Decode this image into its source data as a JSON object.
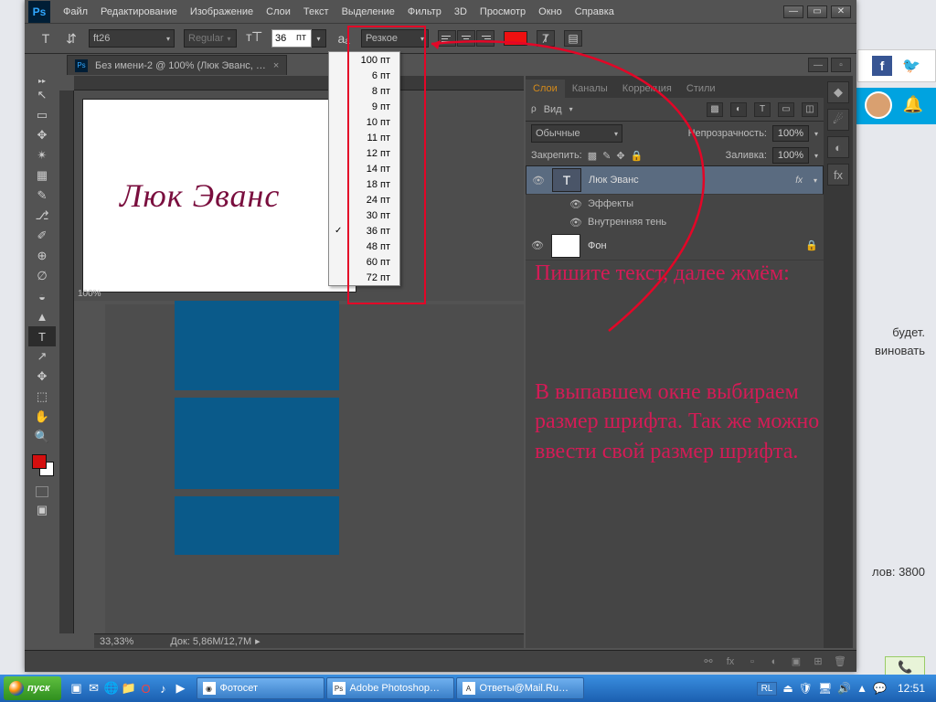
{
  "menubar": {
    "logo": "Ps",
    "items": [
      "Файл",
      "Редактирование",
      "Изображение",
      "Слои",
      "Текст",
      "Выделение",
      "Фильтр",
      "3D",
      "Просмотр",
      "Окно",
      "Справка"
    ]
  },
  "options": {
    "font": "ft26",
    "style": "Regular",
    "size_value": "36",
    "size_unit": "пт",
    "aa": "Резкое"
  },
  "doc": {
    "title": "Без имени-2 @ 100% (Люк Эванс, …",
    "zoom_inner": "100%",
    "zoom_outer": "33,33%",
    "docsize": "Док: 5,86M/12,7M"
  },
  "canvas_text": "Люк Эванс",
  "sizes": [
    "100 пт",
    "6 пт",
    "8 пт",
    "9 пт",
    "10 пт",
    "11 пт",
    "12 пт",
    "14 пт",
    "18 пт",
    "24 пт",
    "30 пт",
    "36 пт",
    "48 пт",
    "60 пт",
    "72 пт"
  ],
  "size_selected_index": 11,
  "panels": {
    "tabs": [
      "Слои",
      "Каналы",
      "Коррекция",
      "Стили"
    ],
    "kind": "Вид",
    "blend": "Обычные",
    "opacity_label": "Непрозрачность:",
    "opacity": "100%",
    "lock_label": "Закрепить:",
    "fill_label": "Заливка:",
    "fill": "100%",
    "layers": [
      {
        "name": "Люк Эванс",
        "fx": "fx"
      },
      {
        "name": "Фон"
      }
    ],
    "fx_group": "Эффекты",
    "fx_item": "Внутренняя тень"
  },
  "annotation": {
    "l1": "Пишите текст, далее жмём:",
    "l2": "В выпавшем окне выбираем размер шрифта. Так же можно ввести свой размер шрифта."
  },
  "behind": {
    "t1": "будет.",
    "t2": "виновать",
    "t3": "лов: 3800"
  },
  "taskbar": {
    "start": "пуск",
    "tasks": [
      {
        "icon": "◉",
        "label": "Фотосет"
      },
      {
        "icon": "Ps",
        "label": "Adobe Photoshop…"
      },
      {
        "icon": "A",
        "label": "Ответы@Mail.Ru…"
      }
    ],
    "lang": "RL",
    "clock": "12:51"
  },
  "tools": [
    "↖",
    "▭",
    "✥",
    "✴",
    "▦",
    "✎",
    "⎇",
    "✐",
    "⊕",
    "∅",
    "◒",
    "▲",
    "T",
    "↗",
    "✥",
    "⬚",
    "✋",
    "🔍"
  ]
}
